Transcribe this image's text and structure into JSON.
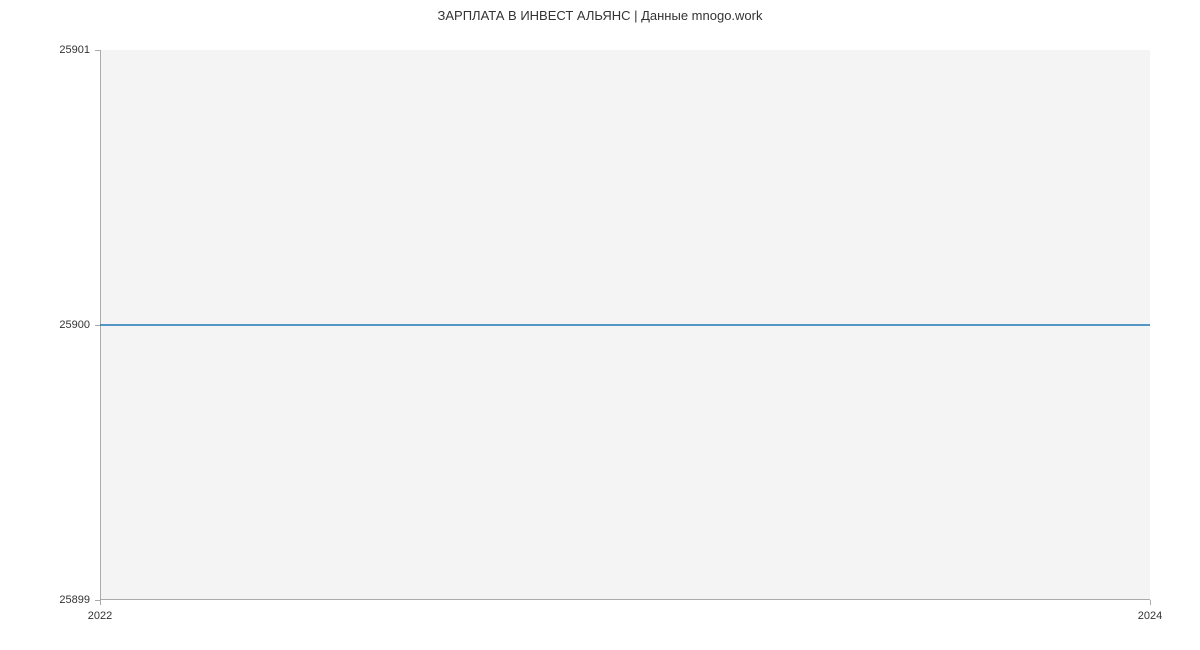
{
  "title": "ЗАРПЛАТА В ИНВЕСТ АЛЬЯНС | Данные mnogo.work",
  "chart_data": {
    "type": "line",
    "title": "ЗАРПЛАТА В ИНВЕСТ АЛЬЯНС | Данные mnogo.work",
    "xlabel": "",
    "ylabel": "",
    "x": [
      2022,
      2024
    ],
    "values": [
      25900,
      25900
    ],
    "xlim": [
      2022,
      2024
    ],
    "ylim": [
      25899,
      25901
    ],
    "y_ticks": [
      25899,
      25900,
      25901
    ],
    "x_ticks": [
      2022,
      2024
    ]
  }
}
